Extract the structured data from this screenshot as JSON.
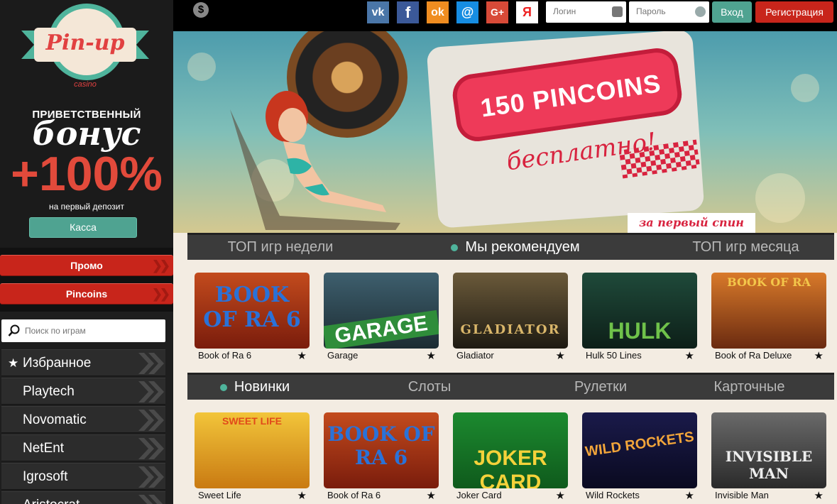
{
  "logo": {
    "brand": "Pin-up",
    "subtitle": "casino"
  },
  "bonus": {
    "label": "ПРИВЕТСТВЕННЫЙ",
    "word": "бонус",
    "percent": "+100%",
    "note": "на первый депозит",
    "cashier_label": "Касса"
  },
  "sidebar": {
    "promo_label": "Промо",
    "pincoins_label": "Pincoins",
    "search_placeholder": "Поиск по играм",
    "providers": [
      "Избранное",
      "Playtech",
      "Novomatic",
      "NetEnt",
      "Igrosoft",
      "Aristocrat"
    ]
  },
  "topbar": {
    "social": [
      "vk",
      "facebook",
      "odnoklassniki",
      "mail.ru",
      "google-plus",
      "yandex"
    ],
    "social_glyphs": [
      "vk",
      "f",
      "ok",
      "@",
      "G+",
      "Я"
    ],
    "login_placeholder": "Логин",
    "password_placeholder": "Пароль",
    "login_button": "Вход",
    "register_button": "Регистрация",
    "currency_glyph": "$"
  },
  "banner": {
    "headline": "150 PINCOINS",
    "subtitle": "бесплатно!",
    "footnote": "за первый спин"
  },
  "tabs_top": [
    {
      "label": "ТОП игр недели",
      "active": false
    },
    {
      "label": "Мы рекомендуем",
      "active": true
    },
    {
      "label": "ТОП игр месяца",
      "active": false
    }
  ],
  "games_top": [
    {
      "name": "Book of Ra 6",
      "thumb_text": "BOOK OF RA 6"
    },
    {
      "name": "Garage",
      "thumb_text": "GARAGE"
    },
    {
      "name": "Gladiator",
      "thumb_text": "GLADIATOR"
    },
    {
      "name": "Hulk 50 Lines",
      "thumb_text": "HULK"
    },
    {
      "name": "Book of Ra Deluxe",
      "thumb_text": "BOOK OF RA"
    }
  ],
  "tabs_bottom": [
    {
      "label": "Новинки",
      "active": true
    },
    {
      "label": "Слоты",
      "active": false
    },
    {
      "label": "Рулетки",
      "active": false
    },
    {
      "label": "Карточные",
      "active": false
    }
  ],
  "games_bottom": [
    {
      "name": "Sweet Life",
      "thumb_text": "SWEET LIFE"
    },
    {
      "name": "Book of Ra 6",
      "thumb_text": "BOOK OF RA 6"
    },
    {
      "name": "Joker Card",
      "thumb_text": "JOKER CARD"
    },
    {
      "name": "Wild Rockets",
      "thumb_text": "WILD ROCKETS"
    },
    {
      "name": "Invisible Man",
      "thumb_text": "INVISIBLE MAN"
    }
  ],
  "colors": {
    "accent_green": "#4fa391",
    "accent_red": "#c8251b",
    "banner_pink": "#ee3a59"
  }
}
